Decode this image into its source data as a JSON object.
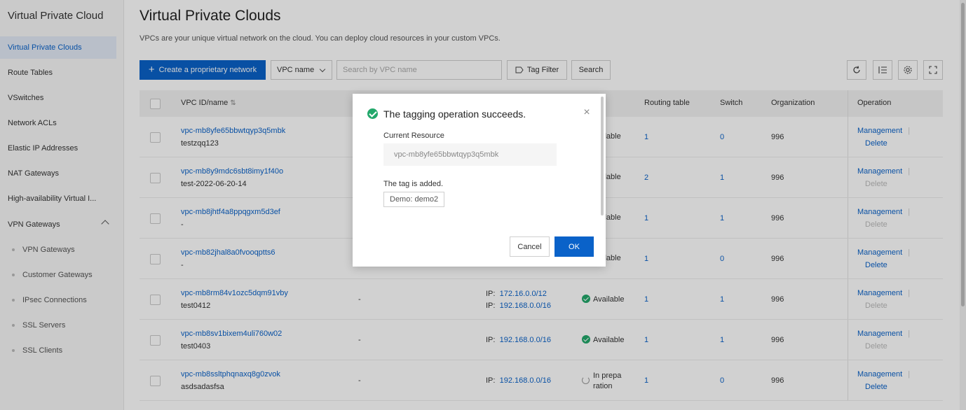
{
  "sidebar": {
    "title": "Virtual Private Cloud",
    "items": [
      {
        "label": "Virtual Private Clouds"
      },
      {
        "label": "Route Tables"
      },
      {
        "label": "VSwitches"
      },
      {
        "label": "Network ACLs"
      },
      {
        "label": "Elastic IP Addresses"
      },
      {
        "label": "NAT Gateways"
      },
      {
        "label": "High-availability Virtual I..."
      },
      {
        "label": "VPN Gateways"
      }
    ],
    "sub_items": [
      {
        "label": "VPN Gateways"
      },
      {
        "label": "Customer Gateways"
      },
      {
        "label": "IPsec Connections"
      },
      {
        "label": "SSL Servers"
      },
      {
        "label": "SSL Clients"
      }
    ]
  },
  "main": {
    "title": "Virtual Private Clouds",
    "description": "VPCs are your unique virtual network on the cloud. You can deploy cloud resources in your custom VPCs."
  },
  "toolbar": {
    "create_label": "Create a proprietary network",
    "filter_select": "VPC name",
    "search_placeholder": "Search by VPC name",
    "tag_filter_label": "Tag Filter",
    "search_label": "Search"
  },
  "table": {
    "headers": {
      "id_name": "VPC ID/name",
      "routing_table": "Routing table",
      "switch": "Switch",
      "organization": "Organization",
      "operation": "Operation"
    },
    "ip_prefix": "IP:",
    "manage_label": "Management",
    "delete_label": "Delete",
    "rows": [
      {
        "id": "vpc-mb8yfe65bbwtqyp3q5mbk",
        "name": "testzqq123",
        "dash": "",
        "ip1": "",
        "ip2": "",
        "status": "ilable",
        "routing": "1",
        "switch": "0",
        "org": "996"
      },
      {
        "id": "vpc-mb8y9mdc6sbt8imy1f40o",
        "name": "test-2022-06-20-14",
        "dash": "",
        "ip1": "",
        "ip2": "",
        "status": "ilable",
        "routing": "2",
        "switch": "1",
        "org": "996"
      },
      {
        "id": "vpc-mb8jhtf4a8ppqgxm5d3ef",
        "name": "-",
        "dash": "",
        "ip1": "",
        "ip2": "",
        "status": "ilable",
        "routing": "1",
        "switch": "1",
        "org": "996"
      },
      {
        "id": "vpc-mb82jhal8a0fvooqptts6",
        "name": "-",
        "dash": "",
        "ip1": "",
        "ip2": "",
        "status": "ilable",
        "routing": "1",
        "switch": "0",
        "org": "996"
      },
      {
        "id": "vpc-mb8rm84v1ozc5dqm91vby",
        "name": "test0412",
        "dash": "-",
        "ip1": "172.16.0.0/12",
        "ip2": "192.168.0.0/16",
        "status": "Available",
        "routing": "1",
        "switch": "1",
        "org": "996"
      },
      {
        "id": "vpc-mb8sv1bixem4uli760w02",
        "name": "test0403",
        "dash": "-",
        "ip1": "192.168.0.0/16",
        "ip2": "",
        "status": "Available",
        "routing": "1",
        "switch": "1",
        "org": "996"
      },
      {
        "id": "vpc-mb8ssltphqnaxq8g0zvok",
        "name": "asdsadasfsa",
        "dash": "-",
        "ip1": "192.168.0.0/16",
        "ip2": "",
        "status_line1": "In prepa",
        "status_line2": "ration",
        "routing": "1",
        "switch": "0",
        "org": "996"
      }
    ]
  },
  "dialog": {
    "title": "The tagging operation succeeds.",
    "current_resource_label": "Current Resource",
    "current_resource_value": "vpc-mb8yfe65bbwtqyp3q5mbk",
    "tag_added_label": "The tag is added.",
    "tag_value": "Demo: demo2",
    "cancel_label": "Cancel",
    "ok_label": "OK"
  },
  "colors": {
    "primary": "#0a62c9",
    "success": "#23a86b"
  }
}
